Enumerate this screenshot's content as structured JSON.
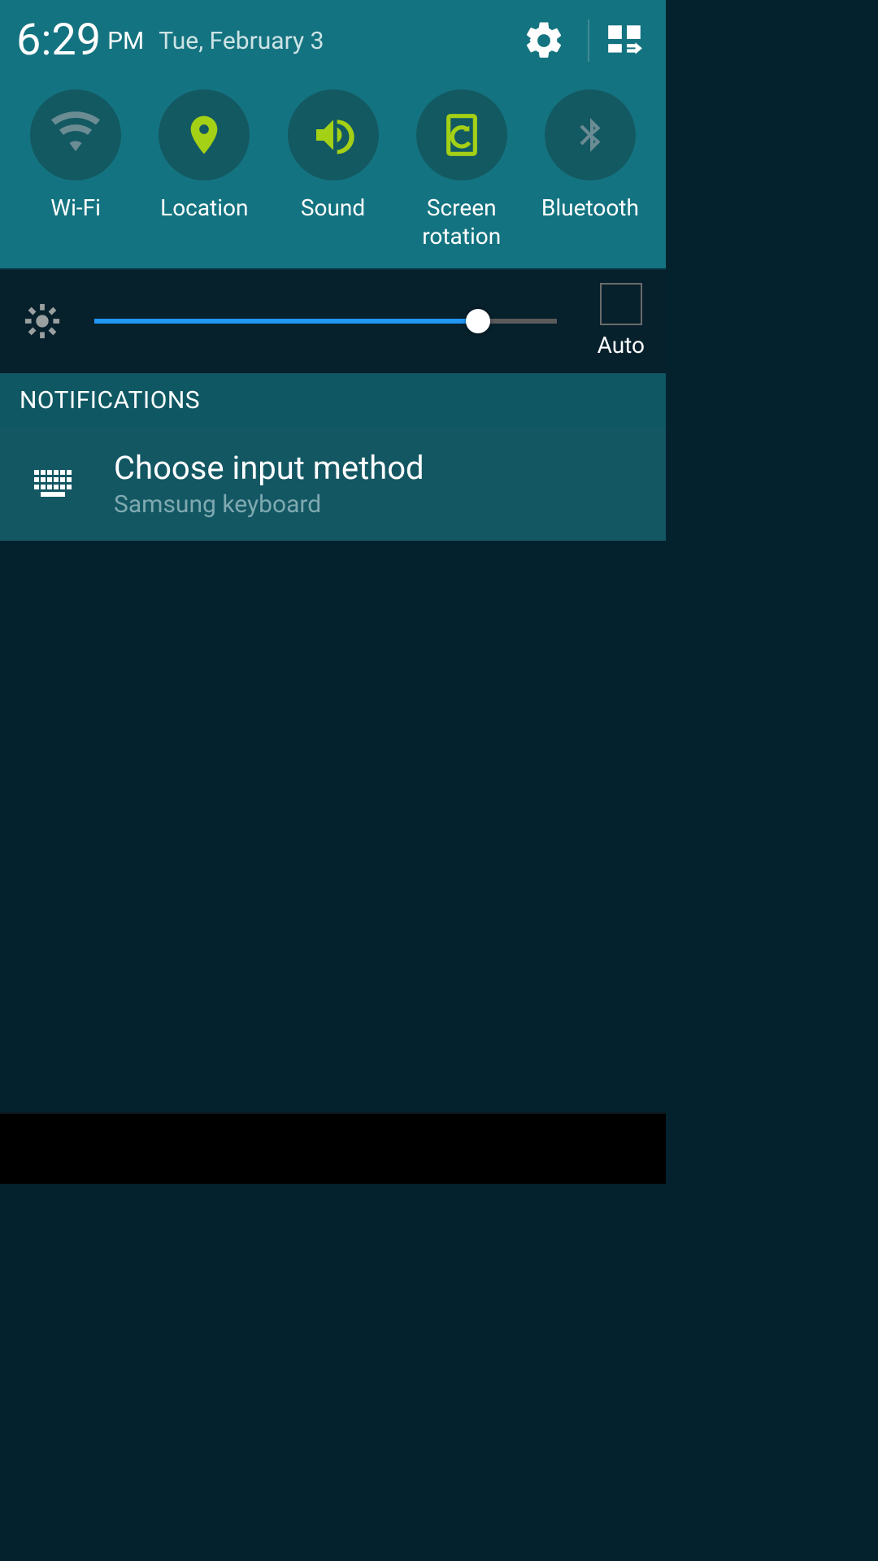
{
  "header": {
    "time": "6:29",
    "ampm": "PM",
    "date": "Tue, February 3"
  },
  "toggles": {
    "wifi": "Wi-Fi",
    "location": "Location",
    "sound": "Sound",
    "screen_rotation": "Screen\nrotation",
    "bluetooth": "Bluetooth"
  },
  "brightness": {
    "auto_label": "Auto",
    "value_percent": 83
  },
  "notifications": {
    "header": "NOTIFICATIONS",
    "items": [
      {
        "title": "Choose input method",
        "subtitle": "Samsung keyboard"
      }
    ]
  },
  "colors": {
    "accent_active": "#a4d016",
    "accent_inactive": "#6c8c94"
  }
}
